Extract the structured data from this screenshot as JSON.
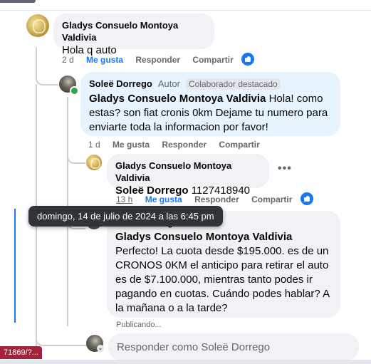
{
  "comments": [
    {
      "author": "Gladys Consuelo Montoya Valdivia",
      "text": "Hola q auto",
      "time": "2 d",
      "like_label": "Me gusta",
      "reply_label": "Responder",
      "share_label": "Compartir"
    },
    {
      "author": "Soleë Dorrego",
      "author_tag": "Autor",
      "badge": "Colaborador destacado",
      "mention": "Gladys Consuelo Montoya Valdivia",
      "text": " Hola! como estas? son fiat cronis 0km Dejame tu numero para enviarte toda la informacion por favor!",
      "time": "1 d",
      "like_label": "Me gusta",
      "reply_label": "Responder",
      "share_label": "Compartir"
    },
    {
      "author": "Gladys Consuelo Montoya Valdivia",
      "mention": "Soleë Dorrego",
      "text": " 1127418940",
      "time": "13 h",
      "like_label": "Me gusta",
      "reply_label": "Responder",
      "share_label": "Compartir"
    },
    {
      "author": "Soleë Dorrego",
      "mention": "Gladys Consuelo Montoya Valdivia",
      "text": " Perfecto! La cuota desde $195.000. es de un CRONOS 0KM el anticipo para retirar el auto es de $7.100.000, mientras tanto podes ir pagando en cuotas. Cuándo podes hablar? A la mañana o a la tarde?",
      "status": "Publicando..."
    }
  ],
  "tooltip": "domingo, 14 de julio de 2024 a las 6:45 pm",
  "reply_box": {
    "placeholder": "Responder como Soleë Dorrego"
  },
  "status_url": "71869/?...",
  "colors": {
    "accent": "#1877f2",
    "bubble": "#f0f2f5",
    "highlight_bubble": "#e7f3ff"
  },
  "icons": [
    "like-reaction-icon",
    "more-options-icon"
  ]
}
